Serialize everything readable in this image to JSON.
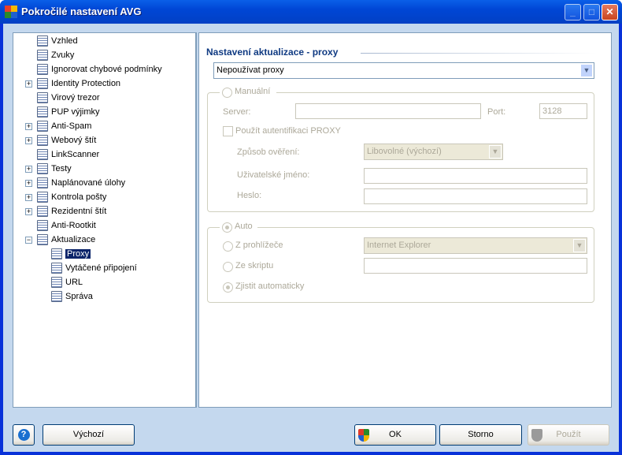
{
  "window": {
    "title": "Pokročilé nastavení AVG",
    "minimize": "_",
    "maximize": "□",
    "close": "✕"
  },
  "tree": {
    "items": [
      {
        "label": "Vzhled",
        "level": 0,
        "expandable": false
      },
      {
        "label": "Zvuky",
        "level": 0,
        "expandable": false
      },
      {
        "label": "Ignorovat chybové podmínky",
        "level": 0,
        "expandable": false
      },
      {
        "label": "Identity Protection",
        "level": 0,
        "expandable": true
      },
      {
        "label": "Virový trezor",
        "level": 0,
        "expandable": false
      },
      {
        "label": "PUP výjimky",
        "level": 0,
        "expandable": false
      },
      {
        "label": "Anti-Spam",
        "level": 0,
        "expandable": true
      },
      {
        "label": "Webový štít",
        "level": 0,
        "expandable": true
      },
      {
        "label": "LinkScanner",
        "level": 0,
        "expandable": false
      },
      {
        "label": "Testy",
        "level": 0,
        "expandable": true
      },
      {
        "label": "Naplánované úlohy",
        "level": 0,
        "expandable": true
      },
      {
        "label": "Kontrola pošty",
        "level": 0,
        "expandable": true
      },
      {
        "label": "Rezidentní štít",
        "level": 0,
        "expandable": true
      },
      {
        "label": "Anti-Rootkit",
        "level": 0,
        "expandable": false
      },
      {
        "label": "Aktualizace",
        "level": 0,
        "expandable": true,
        "expanded": true
      },
      {
        "label": "Proxy",
        "level": 1,
        "selected": true
      },
      {
        "label": "Vytáčené připojení",
        "level": 1
      },
      {
        "label": "URL",
        "level": 1
      },
      {
        "label": "Správa",
        "level": 1
      }
    ]
  },
  "panel": {
    "title": "Nastavení aktualizace - proxy",
    "proxy_mode": "Nepoužívat proxy",
    "manual": {
      "label": "Manuální",
      "server_label": "Server:",
      "server_value": "",
      "port_label": "Port:",
      "port_value": "3128",
      "auth_label": "Použít autentifikaci PROXY",
      "auth_checked": false,
      "auth_method_label": "Způsob ověření:",
      "auth_method_value": "Libovolné (výchozí)",
      "username_label": "Uživatelské jméno:",
      "username_value": "",
      "password_label": "Heslo:",
      "password_value": ""
    },
    "auto": {
      "label": "Auto",
      "browser_label": "Z prohlížeče",
      "browser_value": "Internet Explorer",
      "script_label": "Ze skriptu",
      "script_value": "",
      "detect_label": "Zjistit automaticky"
    }
  },
  "buttons": {
    "help": "?",
    "default": "Výchozí",
    "ok": "OK",
    "cancel": "Storno",
    "apply": "Použít"
  }
}
